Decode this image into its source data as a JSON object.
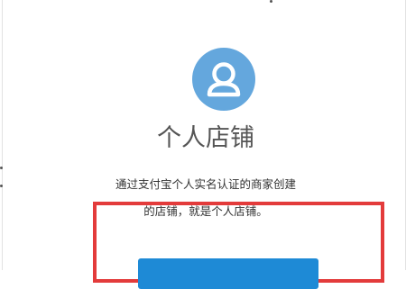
{
  "store": {
    "title": "个人店铺",
    "description_line1": "通过支付宝个人实名认证的商家创建",
    "description_line2": "的店铺，就是个人店铺。",
    "icon": "user-avatar-icon"
  },
  "colors": {
    "avatar_bg": "#64a7dd",
    "button_bg": "#1e8ad6",
    "highlight_border": "#e33b3b"
  }
}
